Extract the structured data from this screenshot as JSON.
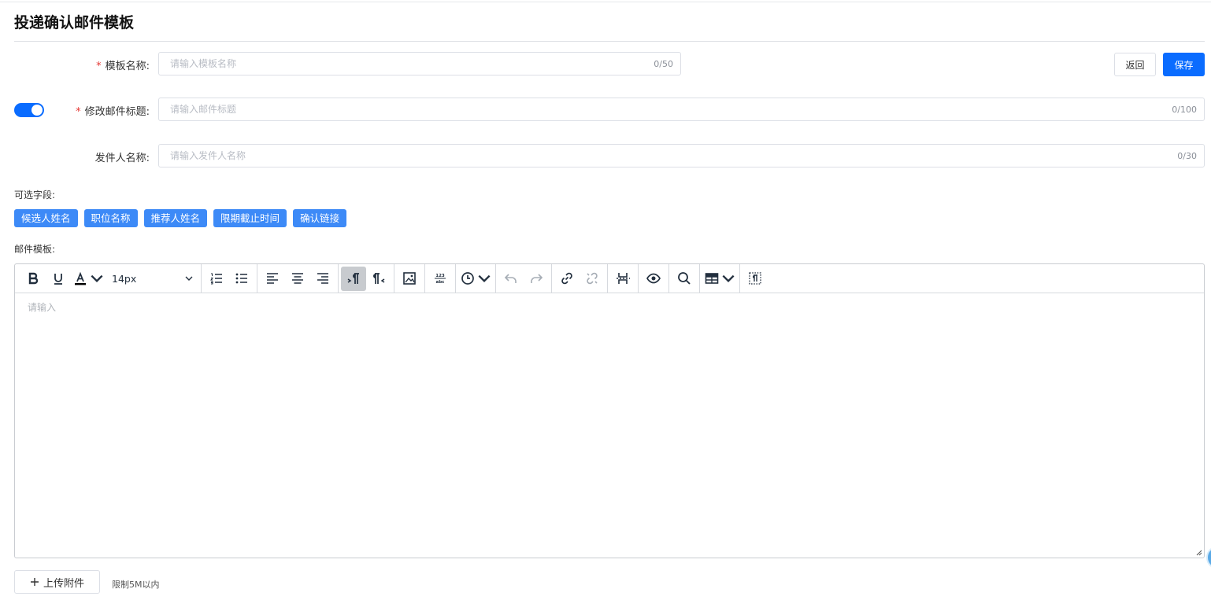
{
  "page": {
    "title": "投递确认邮件模板"
  },
  "form": {
    "template_name": {
      "label": "模板名称:",
      "placeholder": "请输入模板名称",
      "counter": "0/50",
      "required": true
    },
    "mail_subject": {
      "label": "修改邮件标题:",
      "placeholder": "请输入邮件标题",
      "counter": "0/100",
      "required": true,
      "toggle_on": true
    },
    "sender_name": {
      "label": "发件人名称:",
      "placeholder": "请输入发件人名称",
      "counter": "0/30",
      "required": false
    },
    "required_mark": "*"
  },
  "actions": {
    "back_label": "返回",
    "save_label": "保存"
  },
  "fields": {
    "label": "可选字段:",
    "chips": [
      "候选人姓名",
      "职位名称",
      "推荐人姓名",
      "限期截止时间",
      "确认链接"
    ]
  },
  "editor": {
    "label": "邮件模板:",
    "font_size": "14px",
    "placeholder": "请输入",
    "toolbar_icons": [
      "bold-icon",
      "underline-icon",
      "text-color-icon",
      "numbered-list-icon",
      "bullet-list-icon",
      "align-left-icon",
      "align-center-icon",
      "align-right-icon",
      "ltr-icon",
      "rtl-icon",
      "image-icon",
      "word-count-icon",
      "clock-icon",
      "undo-icon",
      "redo-icon",
      "link-icon",
      "unlink-icon",
      "page-break-icon",
      "preview-icon",
      "search-icon",
      "table-icon",
      "show-blocks-icon"
    ]
  },
  "upload": {
    "button_label": "上传附件",
    "hint": "限制5M以内"
  },
  "colors": {
    "primary": "#0a6cff",
    "chip": "#3d8af7",
    "required": "#e53935"
  }
}
